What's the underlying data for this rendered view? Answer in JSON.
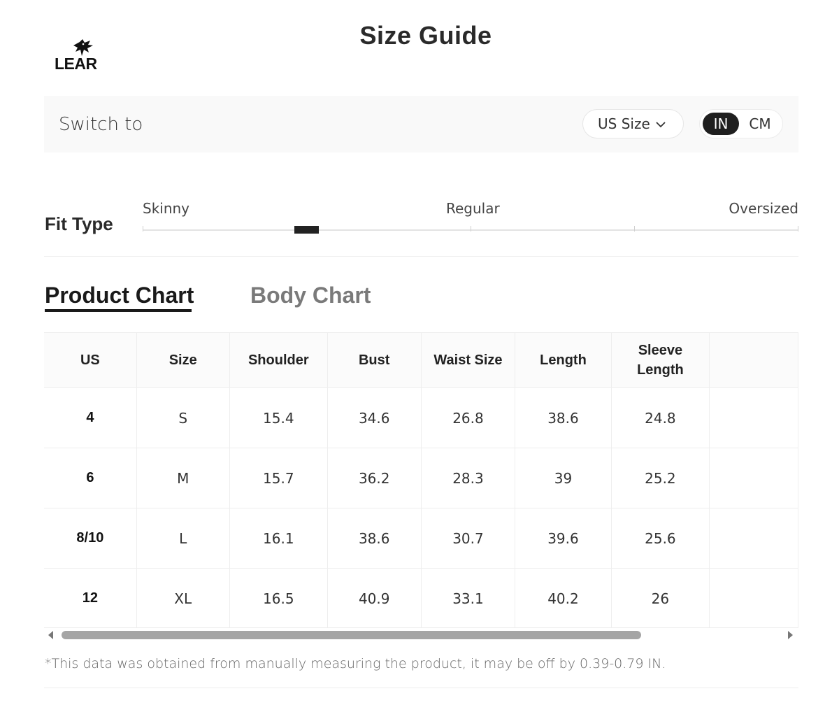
{
  "brand": {
    "logo_text": "LEAR"
  },
  "page_title": "Size Guide",
  "switch_bar": {
    "label": "Switch to",
    "size_system": "US Size",
    "units": [
      "IN",
      "CM"
    ],
    "active_unit": "IN"
  },
  "fit_type": {
    "title": "Fit Type",
    "labels": [
      "Skinny",
      "Regular",
      "Oversized"
    ],
    "level": 0.25
  },
  "tabs": [
    {
      "label": "Product Chart",
      "active": true
    },
    {
      "label": "Body Chart",
      "active": false
    }
  ],
  "table": {
    "headers": [
      "US",
      "Size",
      "Shoulder",
      "Bust",
      "Waist Size",
      "Length",
      "Sleeve Length",
      ""
    ],
    "rows": [
      [
        "4",
        "S",
        "15.4",
        "34.6",
        "26.8",
        "38.6",
        "24.8",
        ""
      ],
      [
        "6",
        "M",
        "15.7",
        "36.2",
        "28.3",
        "39",
        "25.2",
        ""
      ],
      [
        "8/10",
        "L",
        "16.1",
        "38.6",
        "30.7",
        "39.6",
        "25.6",
        ""
      ],
      [
        "12",
        "XL",
        "16.5",
        "40.9",
        "33.1",
        "40.2",
        "26",
        ""
      ]
    ]
  },
  "footnote": "*This data was obtained from manually measuring the product, it may be off by 0.39-0.79 IN."
}
